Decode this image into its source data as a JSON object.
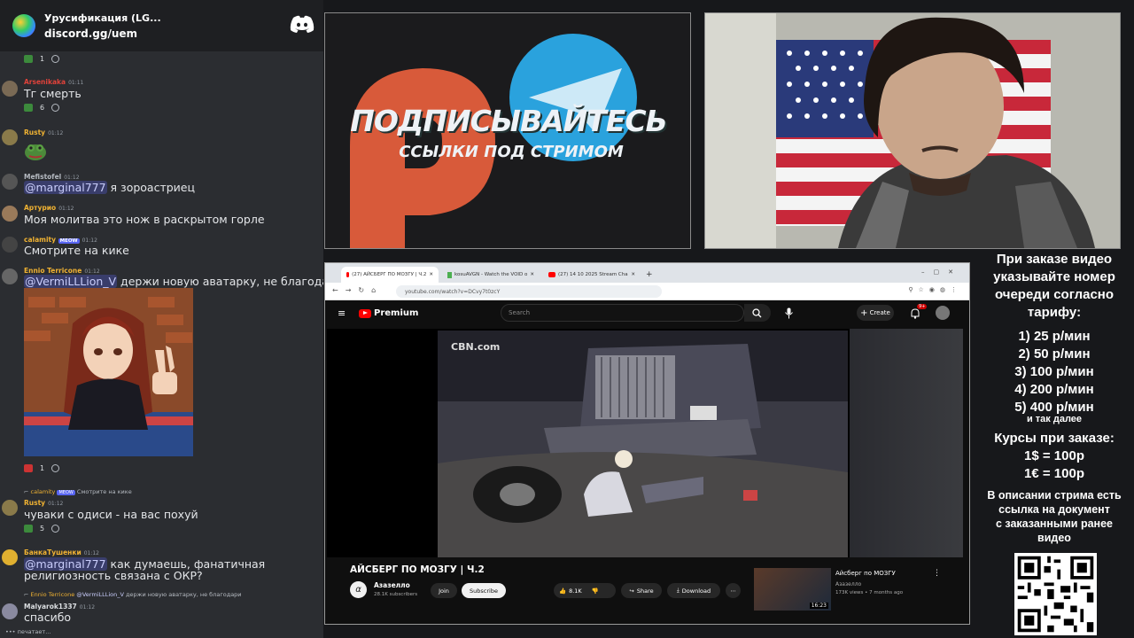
{
  "discord": {
    "server_name": "Урусификация (LG...",
    "invite": "discord.gg/uem",
    "top_reaction_count": "1",
    "messages": [
      {
        "author": "Arsenikaka",
        "time": "01:11",
        "text": "Тг  смерть",
        "reaction_count": "6",
        "color": "#e0423a"
      },
      {
        "author": "Rusty",
        "time": "01:12",
        "text": "",
        "color": "#f0b232"
      },
      {
        "author": "Mefistofel",
        "time": "01:12",
        "mention": "@marginal777",
        "text": " я зороастриец",
        "color": "#b5bac1"
      },
      {
        "author": "Артурио",
        "time": "01:12",
        "text": "Моя молитва это нож в раскрытом горле",
        "color": "#f0b232"
      },
      {
        "author": "calamity",
        "tag": "MEOW",
        "time": "01:12",
        "text": "Смотрите на кике",
        "color": "#f0b232"
      },
      {
        "author": "Ennio Terricone",
        "time": "01:12",
        "mention": "@VermiLLLion_V",
        "text": " держи новую аватарку, не благодари",
        "color": "#f0b232"
      },
      {
        "author": "Rusty",
        "time": "01:12",
        "text": "чуваки с одиси - на вас похуй",
        "reaction_count": "5",
        "color": "#f0b232"
      },
      {
        "author": "БанкаТушенки",
        "time": "01:12",
        "mention": "@marginal777",
        "text": " как думаешь, фанатичная",
        "text2": "религиозность связана с ОКР?",
        "color": "#f0b232"
      },
      {
        "author": "Malyarok1337",
        "time": "01:12",
        "text": "спасибо",
        "color": "#dbdee1"
      }
    ],
    "image_reaction_count": "1",
    "reply1": {
      "author": "calamity",
      "tag": "MEOW",
      "text": "Смотрите на кике"
    },
    "reply2": {
      "author": "Ennio Terricone",
      "mention": "@VermiLLLion_V",
      "text": "держи новую аватарку, не благодари"
    },
    "typing": "печатает..."
  },
  "promo": {
    "line1": "ПОДПИСЫВАЙТЕСЬ",
    "line2": "ССЫЛКИ ПОД СТРИМОМ"
  },
  "browser": {
    "tabs": [
      {
        "label": "(27) АЙСБЕРГ ПО МОЗГУ | Ч.2",
        "active": true
      },
      {
        "label": "kosuAVGN - Watch the VOID o",
        "active": false
      },
      {
        "label": "(27) 14 10 2025 Stream Cha",
        "active": false
      }
    ],
    "url": "youtube.com/watch?v=DCvy7t0zcY",
    "yt_logo": "Premium",
    "search_placeholder": "Search",
    "create_label": "Create",
    "notif_count": "9+",
    "video_watermark": "CBN.com",
    "video_title": "АЙСБЕРГ ПО МОЗГУ | Ч.2",
    "channel_name": "Азазелло",
    "channel_avatar": "α",
    "subscribers": "28.1K subscribers",
    "join_label": "Join",
    "subscribe_label": "Subscribe",
    "like_count": "8.1K",
    "share_label": "Share",
    "download_label": "Download",
    "rec_title": "Айсберг по МОЗГУ",
    "rec_channel": "Азазелло",
    "rec_meta": "173K views • 7 months ago",
    "rec_duration": "16:23"
  },
  "info": {
    "intro": [
      "При заказе видео",
      "указывайте номер",
      "очереди согласно",
      "тарифу:"
    ],
    "tariffs": [
      "1) 25 р/мин",
      "2) 50 р/мин",
      "3) 100 р/мин",
      "4) 200 р/мин",
      "5) 400 р/мин"
    ],
    "etc": "и так далее",
    "rates_title": "Курсы при заказе:",
    "rates": [
      "1$ = 100р",
      "1€ = 100р"
    ],
    "desc": [
      "В описании стрима есть",
      "ссылка на документ",
      "с заказанными ранее",
      "видео"
    ]
  }
}
